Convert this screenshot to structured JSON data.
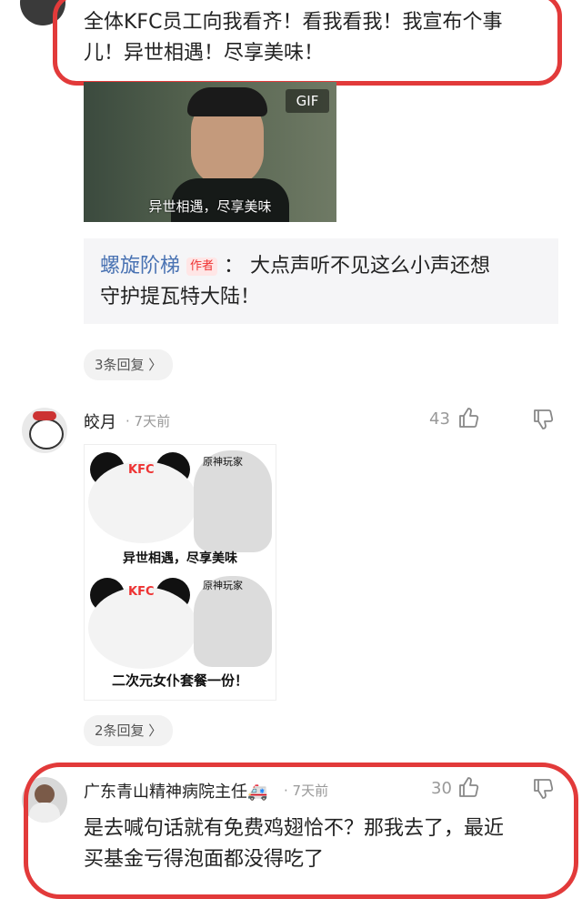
{
  "comment1": {
    "text_line1": "全体KFC员工向我看齐！看我看我！我宣布个事",
    "text_line2": "儿！异世相遇！尽享美味！",
    "gif_badge": "GIF",
    "gif_caption": "异世相遇，尽享美味",
    "reply": {
      "author": "螺旋阶梯",
      "author_tag": "作者",
      "colon": "：",
      "text_line1": "大点声听不见这么小声还想",
      "text_line2": "守护提瓦特大陆！"
    },
    "replies_pill": "3条回复 〉"
  },
  "comment2": {
    "author": "皎月",
    "time": "· 7天前",
    "likes": "43",
    "meme": {
      "top_tag_left": "KFC",
      "top_tag_right": "原神玩家",
      "caption_top": "异世相遇，尽享美味",
      "bottom_tag_left": "KFC",
      "bottom_tag_right": "原神玩家",
      "caption_bottom": "二次元女仆套餐一份！"
    },
    "replies_pill": "2条回复 〉"
  },
  "comment3": {
    "author": "广东青山精神病院主任🚑",
    "time": "· 7天前",
    "likes": "30",
    "text_line1": "是去喊句话就有免费鸡翅恰不？那我去了，最近",
    "text_line2": "买基金亏得泡面都没得吃了"
  },
  "colors": {
    "ring": "#e23a3a",
    "author_link": "#4a73b3"
  }
}
